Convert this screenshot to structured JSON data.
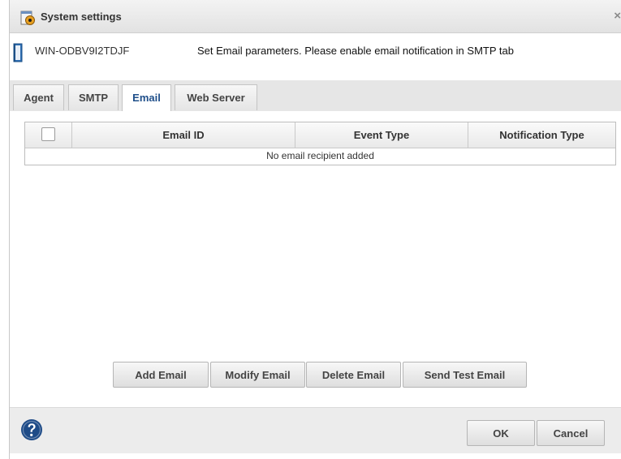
{
  "window": {
    "title": "System settings",
    "close_glyph": "×",
    "title_icon": "settings-gear-icon"
  },
  "header": {
    "machine_name": "WIN-ODBV9I2TDJF",
    "machine_icon": "server-icon",
    "info_text": "Set Email parameters. Please enable email notification in SMTP tab"
  },
  "tabs": [
    {
      "label": "Agent",
      "active": false
    },
    {
      "label": "SMTP",
      "active": false
    },
    {
      "label": "Email",
      "active": true
    },
    {
      "label": "Web Server",
      "active": false
    }
  ],
  "table": {
    "columns": [
      "Email ID",
      "Event Type",
      "Notification Type"
    ],
    "select_all_checked": false,
    "empty_message": "No email recipient added"
  },
  "actions": {
    "add": "Add Email",
    "modify": "Modify Email",
    "delete": "Delete Email",
    "test": "Send Test Email"
  },
  "footer": {
    "help_icon": "help-question-icon",
    "ok": "OK",
    "cancel": "Cancel"
  },
  "colors": {
    "active_tab_text": "#1f4f8a",
    "help_icon": "#1e4b87",
    "title_icon_accent": "#e8a020"
  }
}
